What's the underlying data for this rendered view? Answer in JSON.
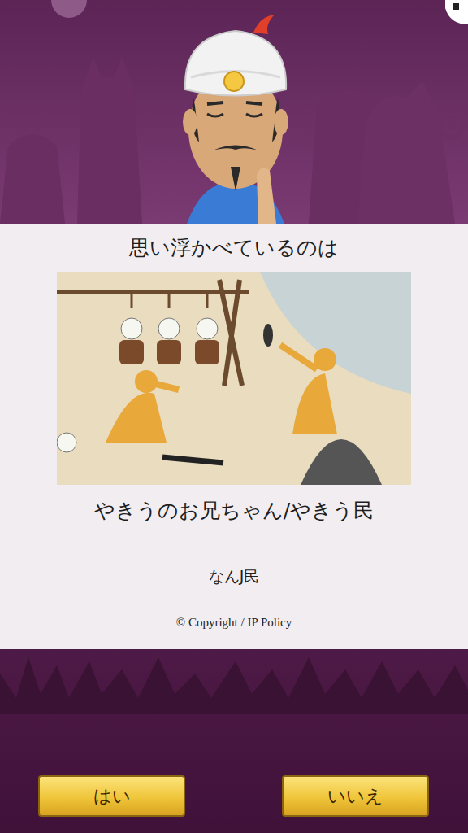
{
  "guess": {
    "prompt": "思い浮かべているのは",
    "name": "やきうのお兄ちゃん/やきう民",
    "description": "なんJ民",
    "copyright": "© Copyright / IP Policy"
  },
  "buttons": [
    {
      "label": "はい"
    },
    {
      "label": "いいえ"
    }
  ]
}
